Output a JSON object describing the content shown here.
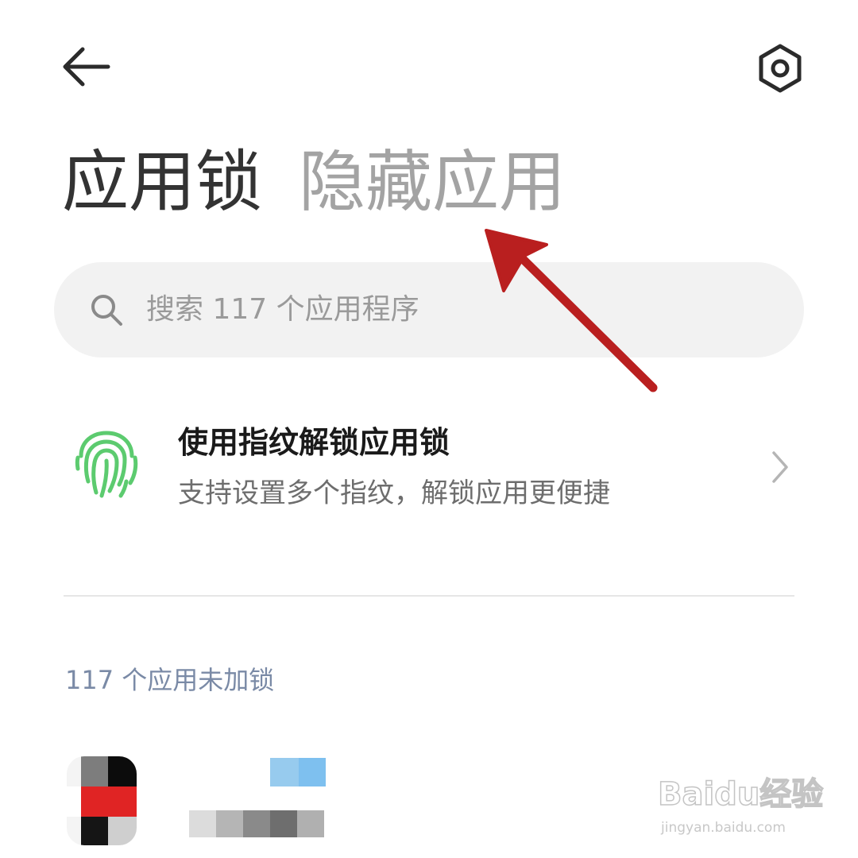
{
  "header": {
    "back_icon": "arrow-left-icon",
    "settings_icon": "hexagon-settings-icon"
  },
  "tabs": [
    {
      "label": "应用锁",
      "active": true
    },
    {
      "label": "隐藏应用",
      "active": false
    }
  ],
  "search": {
    "placeholder": "搜索 117 个应用程序",
    "icon": "search-icon"
  },
  "fingerprint_row": {
    "icon": "fingerprint-icon",
    "icon_color": "#5ccb6f",
    "title": "使用指纹解锁应用锁",
    "subtitle": "支持设置多个指纹，解锁应用更便捷"
  },
  "section": {
    "header": "117 个应用未加锁",
    "header_color": "#7a8aa6"
  },
  "annotation": {
    "type": "arrow",
    "color": "#b91f1f",
    "points_to": "隐藏应用"
  },
  "watermark": {
    "logo": "Baidu经验",
    "url": "jingyan.baidu.com"
  }
}
